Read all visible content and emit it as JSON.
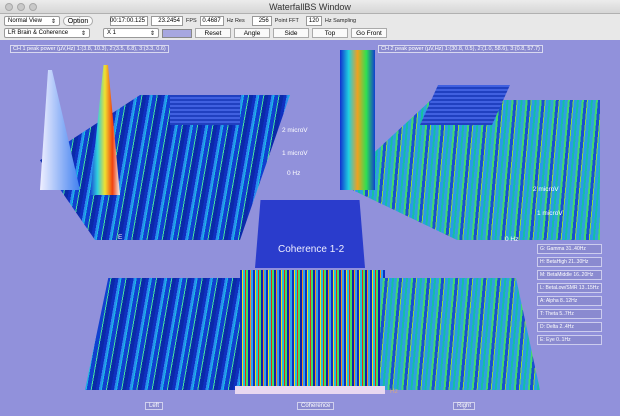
{
  "window": {
    "title": "WaterfallBS Window"
  },
  "toolbar": {
    "view_select": "Normal View",
    "option_label": "Option",
    "time": "00:17:00.125",
    "fps_value": "23.2454",
    "fps_label": "FPS",
    "hz_res_value": "0.4687",
    "hz_res_label": "Hz Res",
    "fft_value": "256",
    "fft_label": "Point FFT",
    "sampling_value": "120",
    "sampling_label": "Hz Sampling",
    "mode_select": "LR Brain & Coherence",
    "scale_select": "X 1",
    "color_swatch": "#a7a7e0",
    "reset_label": "Reset",
    "angle_label": "Angle",
    "side_label": "Side",
    "top_label": "Top",
    "go_front_label": "Go Front"
  },
  "view": {
    "ch1_caption": "CH 1 peak power (µV,Hz) 1:(3.8, 10.3), 2:(3.5, 6.8), 3:(3.3, 0.6)",
    "ch2_caption": "CH 2 peak power (µV,Hz) 1:(30.8, 0.5), 2:(1.0, 58.6), 3:(0.8, 57.7)",
    "axis_2uv": "2 microV",
    "axis_1uv": "1 microV",
    "axis_0hz": "0 Hz",
    "axis_hz": "Hz",
    "axis_e": "E",
    "coherence_title": "Coherence 1-2",
    "bottom": {
      "left": "Left",
      "coherence": "Coherence",
      "right": "Right"
    },
    "legend": [
      "G: Gamma 31..40Hz",
      "H: BetaHigh 21..30Hz",
      "M: BetaMiddle 16..20Hz",
      "L: BetaLow/SMR 13..15Hz",
      "A: Alpha 8..12Hz",
      "T: Theta 5..7Hz",
      "D: Delta 2..4Hz",
      "E: Eye 0..1Hz"
    ]
  },
  "colors": {
    "background": "#9191db",
    "accent": "#1030c0"
  }
}
